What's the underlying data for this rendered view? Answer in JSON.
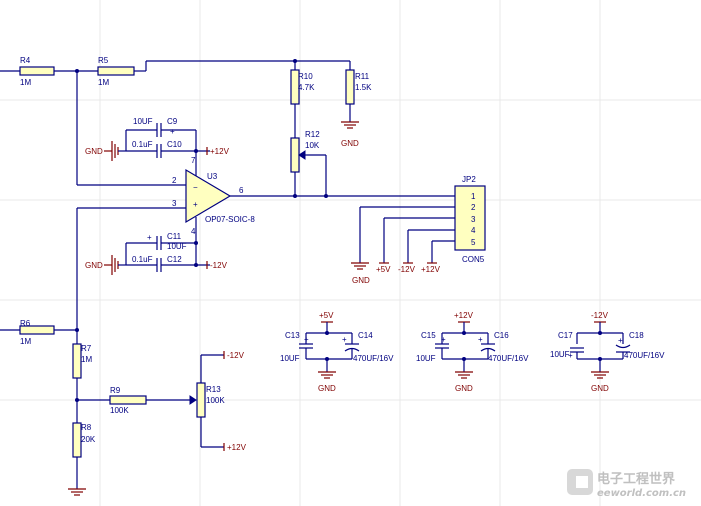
{
  "labels": {
    "r4": "R4",
    "r4v": "1M",
    "r5": "R5",
    "r5v": "1M",
    "r10": "R10",
    "r10v": "4.7K",
    "r11": "R11",
    "r11v": "1.5K",
    "r12": "R12",
    "r12v": "10K",
    "c9v": "10UF",
    "c9": "C9",
    "c10v": "0.1uF",
    "c10": "C10",
    "c11": "C11",
    "c11v": "10UF",
    "c12v": "0.1uF",
    "c12": "C12",
    "u3": "U3",
    "u3part": "OP07-SOIC-8",
    "pin2": "2",
    "pin3": "3",
    "pin6": "6",
    "pin7": "7",
    "pin4": "4",
    "jp2": "JP2",
    "con5": "CON5",
    "jp1": "1",
    "jp2p": "2",
    "jp3": "3",
    "jp4": "4",
    "jp5": "5",
    "r6": "R6",
    "r6v": "1M",
    "r7": "R7",
    "r7v": "1M",
    "r8": "R8",
    "r8v": "20K",
    "r9": "R9",
    "r9v": "100K",
    "r13": "R13",
    "r13v": "100K",
    "c13": "C13",
    "c13v": "10UF",
    "c14": "C14",
    "c14v": "470UF/16V",
    "c15": "C15",
    "c15v": "10UF",
    "c16": "C16",
    "c16v": "470UF/16V",
    "c17": "C17",
    "c17v": "10UF",
    "c18": "C18",
    "c18v": "470UF/16V"
  },
  "nets": {
    "gnd": "GND",
    "p12": "+12V",
    "m12": "-12V",
    "p5": "+5V",
    "n_c14_gnd": "GND",
    "n_c16_gnd": "GND",
    "n_c18_gnd": "GND"
  },
  "polarity": {
    "plus": "+"
  },
  "watermark": {
    "cn": "电子工程世界",
    "en": "eeworld.com.cn"
  }
}
